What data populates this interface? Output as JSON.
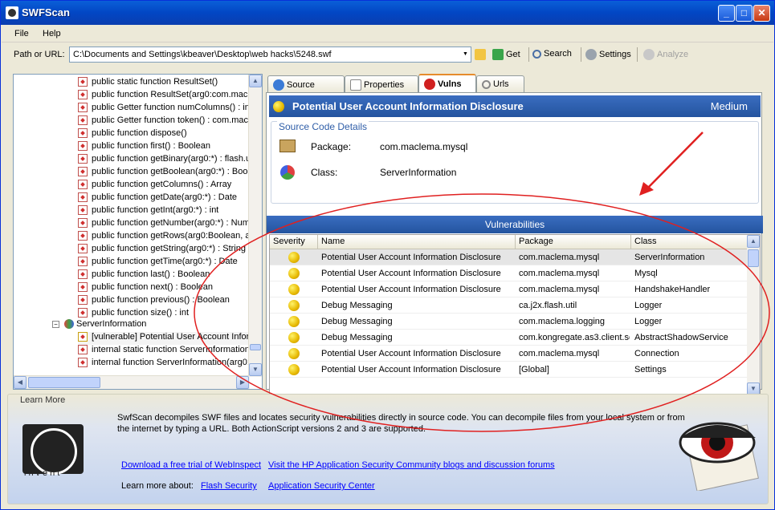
{
  "window": {
    "title": "SWFScan"
  },
  "menu": {
    "file": "File",
    "help": "Help"
  },
  "toolbar": {
    "path_label": "Path or URL:",
    "path_value": "C:\\Documents and Settings\\kbeaver\\Desktop\\web hacks\\5248.swf",
    "get": "Get",
    "search": "Search",
    "settings": "Settings",
    "analyze": "Analyze"
  },
  "tree": {
    "items": [
      "public static function ResultSet()",
      "public function ResultSet(arg0:com.macl",
      "public Getter function numColumns() : int",
      "public Getter function token() : com.mac",
      "public function dispose()",
      "public function first() : Boolean",
      "public function getBinary(arg0:*) : flash.u",
      "public function getBoolean(arg0:*) : Bool",
      "public function getColumns() : Array",
      "public function getDate(arg0:*) : Date",
      "public function getInt(arg0:*) : int",
      "public function getNumber(arg0:*) : Num",
      "public function getRows(arg0:Boolean, a",
      "public function getString(arg0:*) : String",
      "public function getTime(arg0:*) : Date",
      "public function last() : Boolean",
      "public function next() : Boolean",
      "public function previous() : Boolean",
      "public function size() : int"
    ],
    "class_node": "ServerInformation",
    "sub_items": [
      "[vulnerable] Potential User Account Infor",
      "internal static function ServerInformation",
      "internal function ServerInformation(arg0:"
    ]
  },
  "tabs": [
    "Source",
    "Properties",
    "Vulns",
    "Urls"
  ],
  "vuln_detail": {
    "title": "Potential User Account Information Disclosure",
    "severity": "Medium",
    "section": "Source Code Details",
    "package_label": "Package:",
    "package_value": "com.maclema.mysql",
    "class_label": "Class:",
    "class_value": "ServerInformation"
  },
  "vulns": {
    "title": "Vulnerabilities",
    "columns": [
      "Severity",
      "Name",
      "Package",
      "Class"
    ],
    "rows": [
      [
        "Potential User Account Information Disclosure",
        "com.maclema.mysql",
        "ServerInformation"
      ],
      [
        "Potential User Account Information Disclosure",
        "com.maclema.mysql",
        "Mysql"
      ],
      [
        "Potential User Account Information Disclosure",
        "com.maclema.mysql",
        "HandshakeHandler"
      ],
      [
        "Debug Messaging",
        "ca.j2x.flash.util",
        "Logger"
      ],
      [
        "Debug Messaging",
        "com.maclema.logging",
        "Logger"
      ],
      [
        "Debug Messaging",
        "com.kongregate.as3.client.se",
        "AbstractShadowService"
      ],
      [
        "Potential User Account Information Disclosure",
        "com.maclema.mysql",
        "Connection"
      ],
      [
        "Potential User Account Information Disclosure",
        "[Global]",
        "Settings"
      ]
    ]
  },
  "learn": {
    "title": "Learn More",
    "text1": "SwfScan decompiles SWF files and locates security vulnerabilities directly in source code.  You can decompile files from your local system or from",
    "text2": "the internet by typing a URL.  Both ActionScript versions 2 and 3 are supported.",
    "link1": "Download a free trial of WebInspect",
    "link2": "Visit the HP Application Security Community blogs and discussion forums",
    "learn_label": "Learn more about:",
    "link3": "Flash Security",
    "link4": "Application Security Center",
    "logo_text": "invent"
  },
  "colors": {
    "accent": "#24549f",
    "annotation": "#e02020"
  }
}
